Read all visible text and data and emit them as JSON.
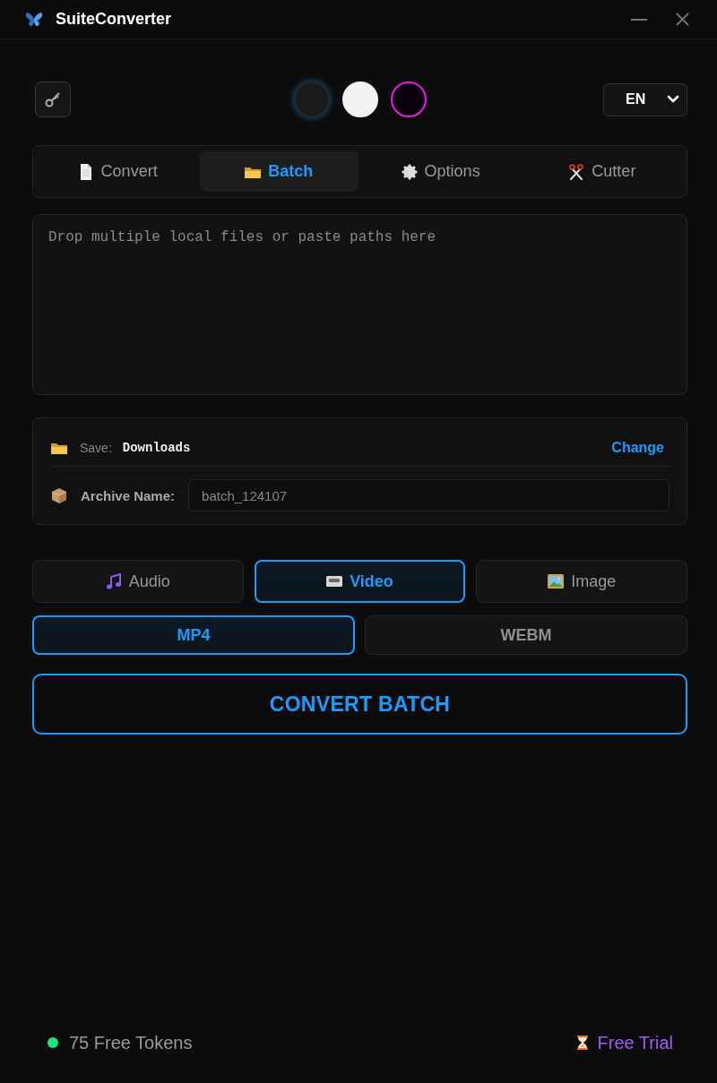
{
  "window": {
    "title": "SuiteConverter"
  },
  "toolbar": {
    "themes": [
      {
        "kind": "dark",
        "color": "#1a1a1a",
        "selected": true
      },
      {
        "kind": "light",
        "color": "#f2f2f2",
        "selected": false
      },
      {
        "kind": "neon",
        "color": "#0a0012",
        "selected": false
      }
    ],
    "language": {
      "value": "EN"
    }
  },
  "tabs": [
    {
      "label": "Convert",
      "kind": "document",
      "selected": false
    },
    {
      "label": "Batch",
      "kind": "folder",
      "selected": true
    },
    {
      "label": "Options",
      "kind": "gear",
      "selected": false
    },
    {
      "label": "Cutter",
      "kind": "scissors",
      "selected": false
    }
  ],
  "batch_input": {
    "placeholder": "Drop multiple local files or paste paths here"
  },
  "save_panel": {
    "save_label": "Save:",
    "folder": "Downloads",
    "change": "Change",
    "archive_label": "Archive Name:",
    "archive_value": "batch_124107"
  },
  "categories": [
    {
      "label": "Audio",
      "kind": "music",
      "selected": false
    },
    {
      "label": "Video",
      "kind": "videotape",
      "selected": true
    },
    {
      "label": "Image",
      "kind": "picture",
      "selected": false
    }
  ],
  "formats": [
    {
      "label": "MP4",
      "selected": true
    },
    {
      "label": "WEBM",
      "selected": false
    }
  ],
  "convert_button": {
    "label": "CONVERT BATCH"
  },
  "footer": {
    "tokens": "75 Free Tokens",
    "trial": "Free Trial"
  }
}
